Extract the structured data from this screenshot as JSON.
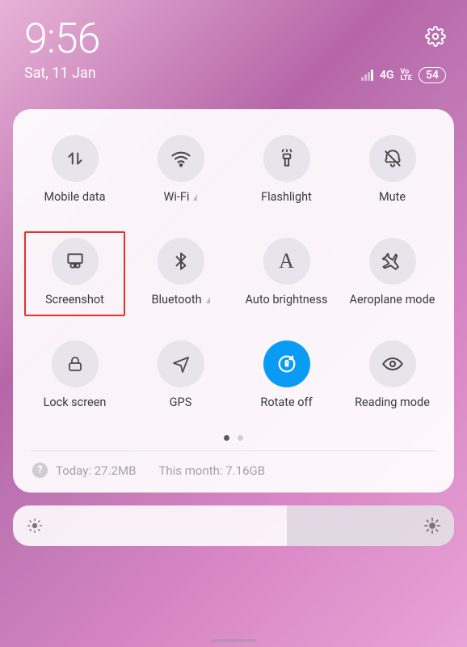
{
  "header": {
    "time": "9:56",
    "date": "Sat, 11 Jan",
    "network": "4G",
    "volte_top": "Vo",
    "volte_bottom": "LTE",
    "battery": "54"
  },
  "tiles": {
    "mobile_data": "Mobile data",
    "wifi": "Wi-Fi",
    "flashlight": "Flashlight",
    "mute": "Mute",
    "screenshot": "Screenshot",
    "bluetooth": "Bluetooth",
    "auto_brightness": "Auto brightness",
    "aeroplane": "Aeroplane mode",
    "lock_screen": "Lock screen",
    "gps": "GPS",
    "rotate": "Rotate off",
    "reading": "Reading mode"
  },
  "usage": {
    "today": "Today: 27.2MB",
    "month": "This month: 7.16GB"
  }
}
